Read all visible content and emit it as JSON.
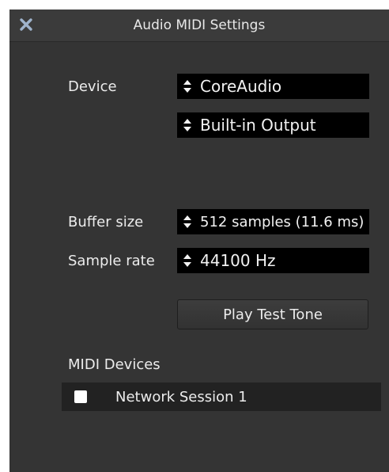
{
  "window": {
    "title": "Audio MIDI Settings",
    "close_icon": "close-x-icon"
  },
  "device": {
    "label": "Device",
    "driver_value": "CoreAudio",
    "output_value": "Built-in Output"
  },
  "buffer": {
    "label": "Buffer size",
    "value": "512 samples (11.6 ms)"
  },
  "sample_rate": {
    "label": "Sample rate",
    "value": "44100 Hz"
  },
  "test_tone": {
    "label": "Play Test Tone"
  },
  "midi": {
    "label": "MIDI Devices",
    "devices": [
      {
        "name": "Network Session 1",
        "checked": false
      }
    ]
  },
  "colors": {
    "window_bg": "#343434",
    "dropdown_bg": "#000000",
    "text": "#ececec"
  }
}
